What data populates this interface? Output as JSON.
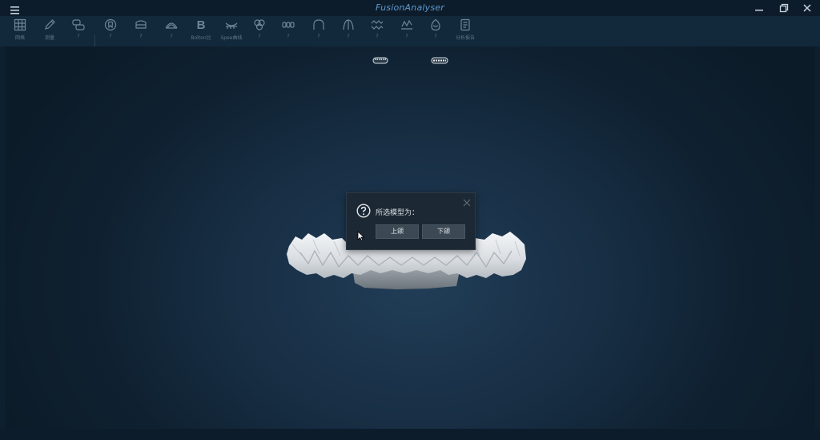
{
  "app": {
    "title": "FusionAnalyser"
  },
  "titlebar": {
    "menu_icon": "hamburger-menu-icon",
    "controls": [
      "minimize-icon",
      "restore-icon",
      "close-icon"
    ]
  },
  "toolbar": {
    "items": [
      {
        "icon": "grid-icon",
        "label": "网格"
      },
      {
        "icon": "pencil-icon",
        "label": "测量"
      },
      {
        "icon": "compare-icon",
        "label": "?"
      },
      {
        "icon": "tooth-circle-icon",
        "label": "?"
      },
      {
        "icon": "arch-box-icon",
        "label": "?"
      },
      {
        "icon": "arch-curve-icon",
        "label": "?"
      },
      {
        "icon": "bolton-icon",
        "label": "Bolton比"
      },
      {
        "icon": "spee-curve-icon",
        "label": "Spee曲线"
      },
      {
        "icon": "molar-icon",
        "label": "?"
      },
      {
        "icon": "teeth-row-icon",
        "label": "?"
      },
      {
        "icon": "arch-outline-icon",
        "label": "?"
      },
      {
        "icon": "arch-pointed-icon",
        "label": "?"
      },
      {
        "icon": "occlusion-icon",
        "label": "?"
      },
      {
        "icon": "wave-chart-icon",
        "label": "?"
      },
      {
        "icon": "egg-icon",
        "label": "?"
      },
      {
        "icon": "report-icon",
        "label": "分析报告"
      }
    ]
  },
  "viewport": {
    "thumbnails": [
      "upper-jaw-thumbnail",
      "lower-jaw-thumbnail"
    ],
    "model": "dental-arch-model"
  },
  "dialog": {
    "message": "所选模型为：",
    "buttons": {
      "upper": "上颌",
      "lower": "下颌"
    }
  }
}
